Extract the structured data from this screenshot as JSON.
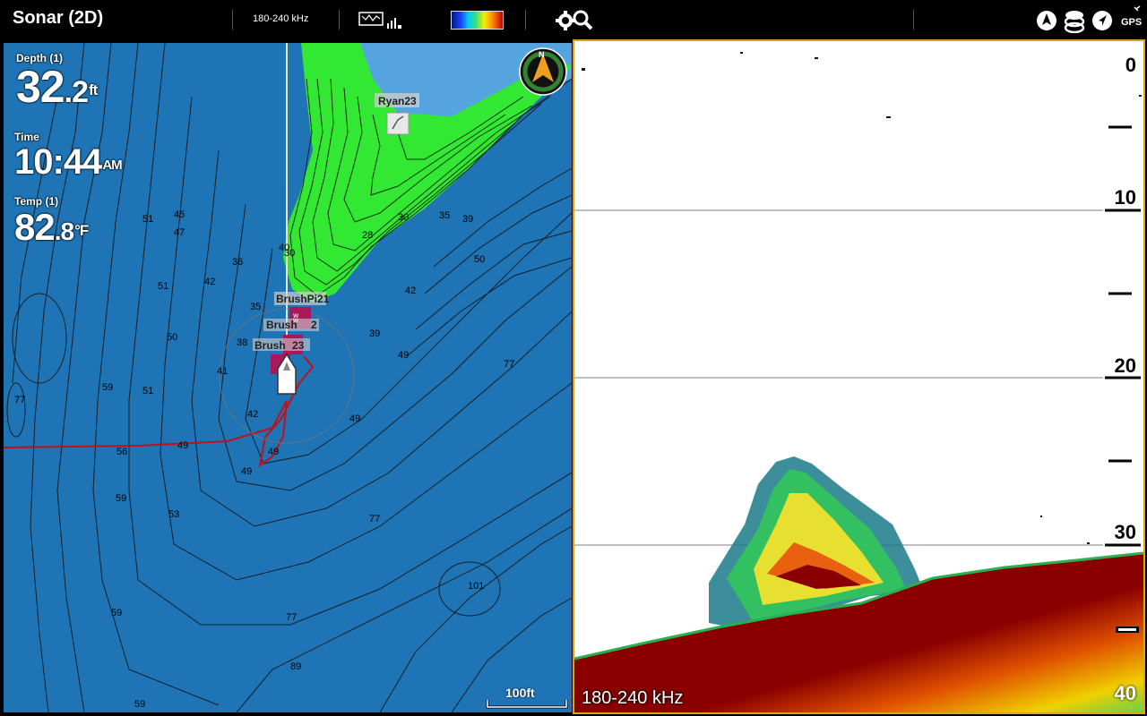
{
  "topbar": {
    "title": "Sonar (2D)",
    "frequency": "180-240 kHz",
    "icons": [
      "chart-sonar-icon",
      "palette-colorbar",
      "settings-search-icon",
      "heading-icon",
      "layers-icon",
      "navigation-icon",
      "gps-icon"
    ],
    "gps_label": "GPS"
  },
  "map": {
    "depth": {
      "label": "Depth (1)",
      "int": "32",
      "dec": ".2",
      "unit": "ft"
    },
    "time": {
      "label": "Time",
      "value": "10:44",
      "ampm": "AM"
    },
    "temp": {
      "label": "Temp (1)",
      "int": "82",
      "dec": ".8",
      "unit": "°F"
    },
    "waypoints": [
      "Ryan23",
      "BrushPi21",
      "Brush",
      "2",
      "Brush",
      "23"
    ],
    "contour_labels": [
      "45",
      "47",
      "51",
      "36",
      "42",
      "38",
      "35",
      "51",
      "50",
      "59",
      "51",
      "41",
      "42",
      "49",
      "56",
      "59",
      "53",
      "49",
      "59",
      "89",
      "77",
      "77",
      "101",
      "77",
      "49",
      "49",
      "50",
      "42",
      "39",
      "30",
      "28",
      "30",
      "35",
      "39",
      "77",
      "49",
      "40",
      "59"
    ],
    "scale": "100ft",
    "compass": "N"
  },
  "sonar": {
    "depth_labels": [
      "0",
      "10",
      "20",
      "30",
      "40"
    ],
    "frequency": "180-240 kHz"
  }
}
